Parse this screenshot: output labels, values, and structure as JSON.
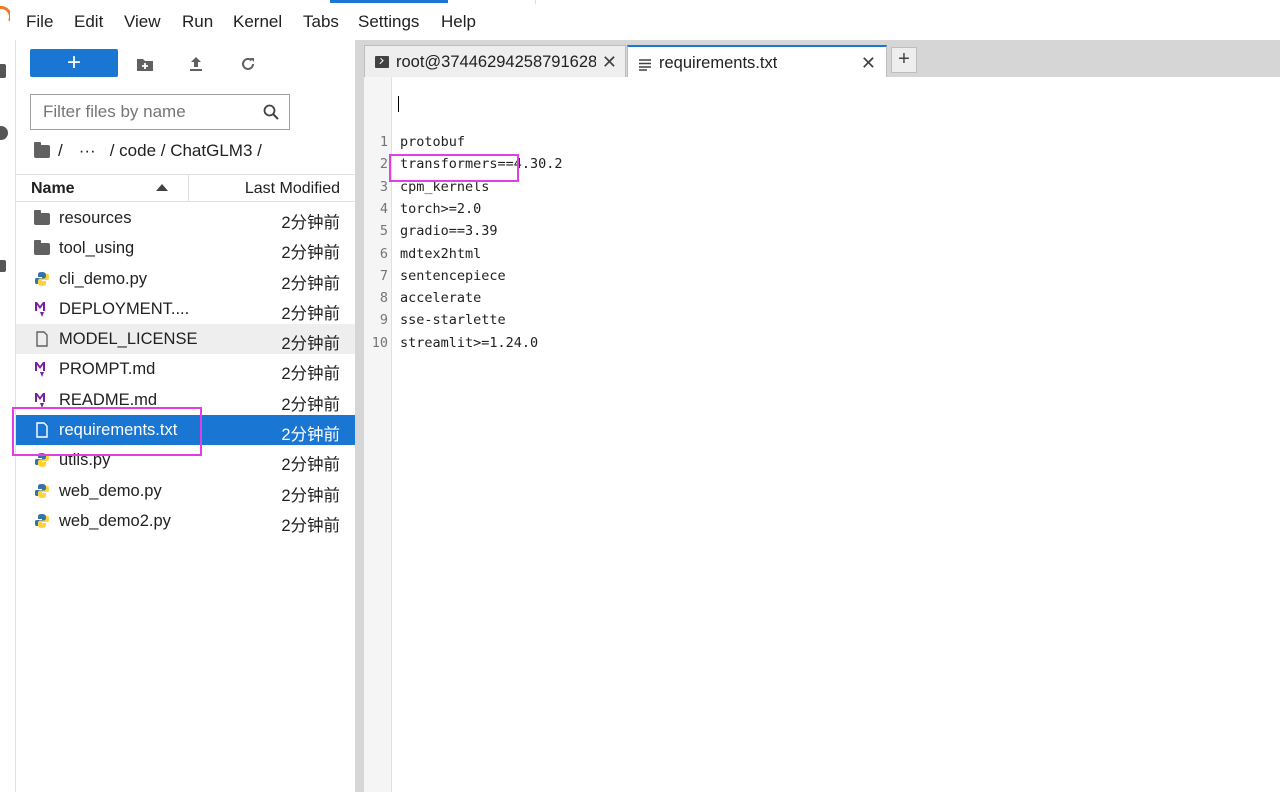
{
  "menu": [
    "File",
    "Edit",
    "View",
    "Run",
    "Kernel",
    "Tabs",
    "Settings",
    "Help"
  ],
  "toolbar": {
    "new_label": "+",
    "icons": [
      "new-folder-icon",
      "upload-icon",
      "refresh-icon"
    ]
  },
  "filter": {
    "placeholder": "Filter files by name"
  },
  "breadcrumb": {
    "root": "/",
    "ellipsis": "···",
    "path": "/ code / ChatGLM3 /"
  },
  "list_header": {
    "name": "Name",
    "modified": "Last Modified"
  },
  "files": [
    {
      "name": "resources",
      "modified": "2分钟前",
      "icon": "folder-icon"
    },
    {
      "name": "tool_using",
      "modified": "2分钟前",
      "icon": "folder-icon"
    },
    {
      "name": "cli_demo.py",
      "modified": "2分钟前",
      "icon": "python-icon"
    },
    {
      "name": "DEPLOYMENT....",
      "modified": "2分钟前",
      "icon": "markdown-icon"
    },
    {
      "name": "MODEL_LICENSE",
      "modified": "2分钟前",
      "icon": "file-icon"
    },
    {
      "name": "PROMPT.md",
      "modified": "2分钟前",
      "icon": "markdown-icon"
    },
    {
      "name": "README.md",
      "modified": "2分钟前",
      "icon": "markdown-icon"
    },
    {
      "name": "requirements.txt",
      "modified": "2分钟前",
      "icon": "file-icon"
    },
    {
      "name": "utils.py",
      "modified": "2分钟前",
      "icon": "python-icon"
    },
    {
      "name": "web_demo.py",
      "modified": "2分钟前",
      "icon": "python-icon"
    },
    {
      "name": "web_demo2.py",
      "modified": "2分钟前",
      "icon": "python-icon"
    }
  ],
  "tabs": [
    {
      "label": "root@37446294258791628",
      "icon": "terminal-icon",
      "close": "✕"
    },
    {
      "label": "requirements.txt",
      "icon": "text-file-icon",
      "close": "✕"
    }
  ],
  "add_tab": "+",
  "editor": {
    "lines": [
      {
        "n": "1",
        "text": "protobuf"
      },
      {
        "n": "2",
        "text": "transformers==4.30.2"
      },
      {
        "n": "3",
        "text": "cpm_kernels"
      },
      {
        "n": "4",
        "text": "torch>=2.0"
      },
      {
        "n": "5",
        "text": "gradio==3.39"
      },
      {
        "n": "6",
        "text": "mdtex2html"
      },
      {
        "n": "7",
        "text": "sentencepiece"
      },
      {
        "n": "8",
        "text": "accelerate"
      },
      {
        "n": "9",
        "text": "sse-starlette"
      },
      {
        "n": "10",
        "text": "streamlit>=1.24.0"
      }
    ]
  },
  "colors": {
    "accent": "#1976d2",
    "highlight": "#e040e0",
    "selected_row": "#1976d2"
  }
}
